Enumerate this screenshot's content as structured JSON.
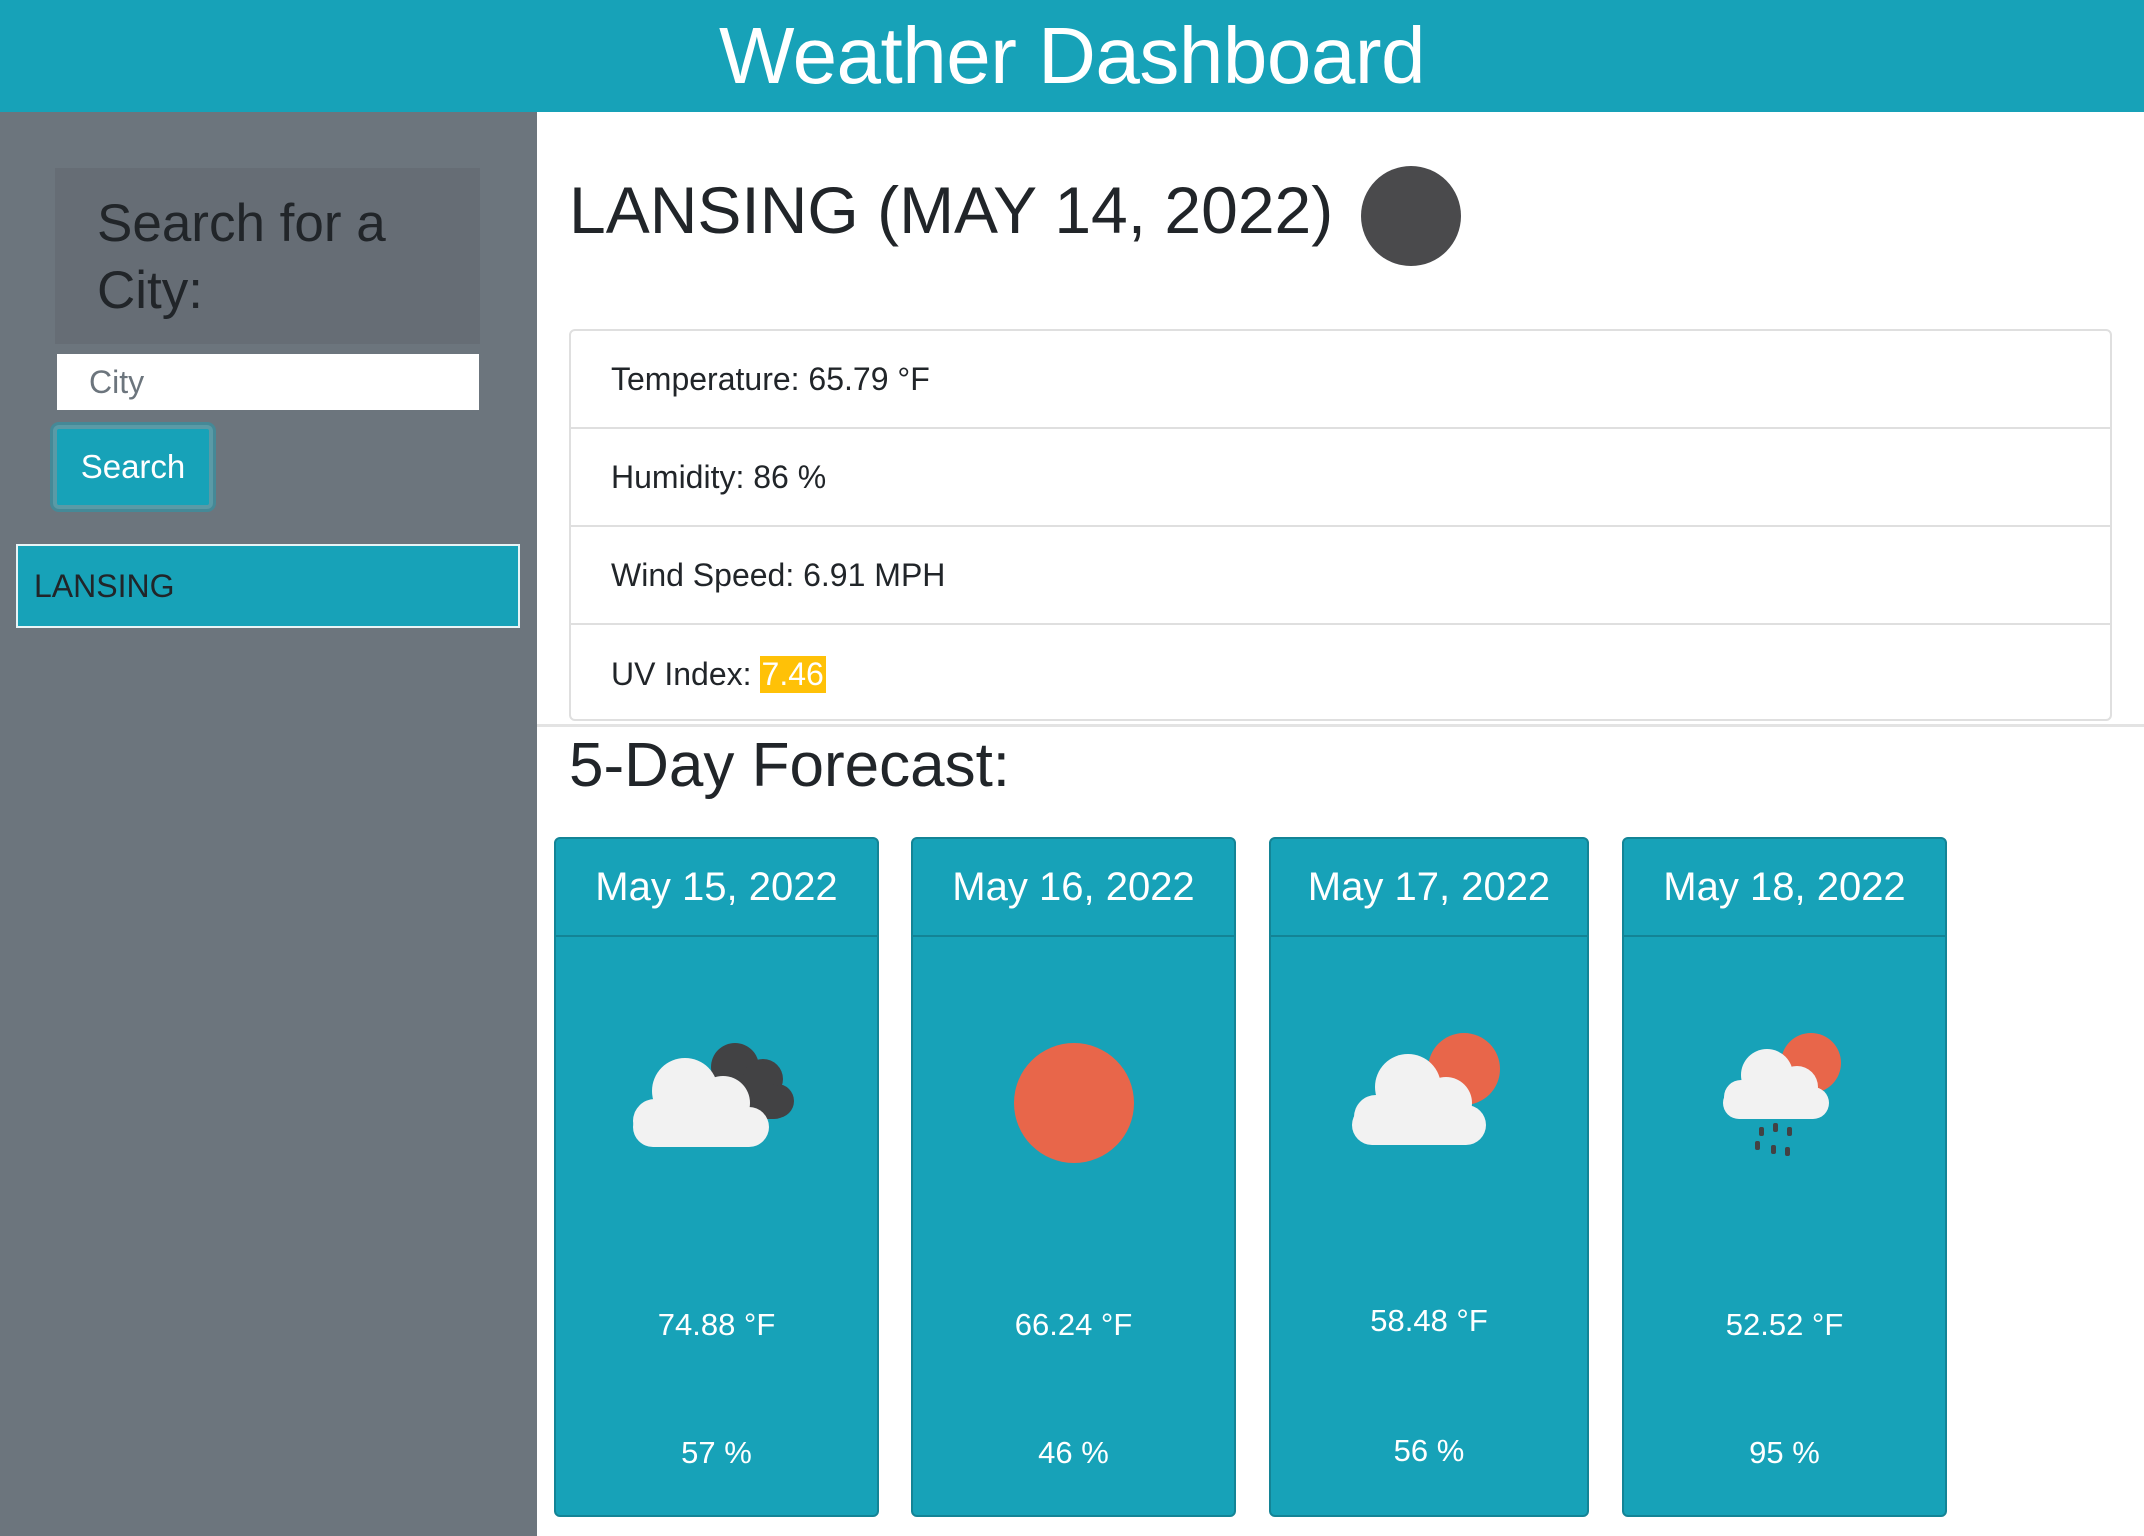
{
  "header": {
    "title": "Weather Dashboard"
  },
  "sidebar": {
    "search_title": "Search for a City:",
    "input_placeholder": "City",
    "input_value": "",
    "search_button": "Search",
    "history": [
      "LANSING"
    ]
  },
  "current": {
    "title": "LANSING (MAY 14, 2022)",
    "icon": "dark-circle-icon",
    "temperature": "Temperature: 65.79 °F",
    "humidity": "Humidity: 86 %",
    "wind": "Wind Speed: 6.91 MPH",
    "uv_label": "UV Index:",
    "uv_value": "7.46",
    "uv_color": "#ffc107"
  },
  "forecast": {
    "title": "5-Day Forecast:",
    "days": [
      {
        "date": "May 15, 2022",
        "icon": "cloud-dark-cloud-icon",
        "temp": "74.88 °F",
        "humidity": "57 %"
      },
      {
        "date": "May 16, 2022",
        "icon": "sun-icon",
        "temp": "66.24 °F",
        "humidity": "46 %"
      },
      {
        "date": "May 17, 2022",
        "icon": "cloud-sun-icon",
        "temp": "58.48 °F",
        "humidity": "56 %"
      },
      {
        "date": "May 18, 2022",
        "icon": "rain-cloud-sun-icon",
        "temp": "52.52 °F",
        "humidity": "95 %"
      }
    ]
  },
  "colors": {
    "accent": "#17a2b8",
    "sidebar": "#6c757d",
    "sun": "#e8664a"
  }
}
